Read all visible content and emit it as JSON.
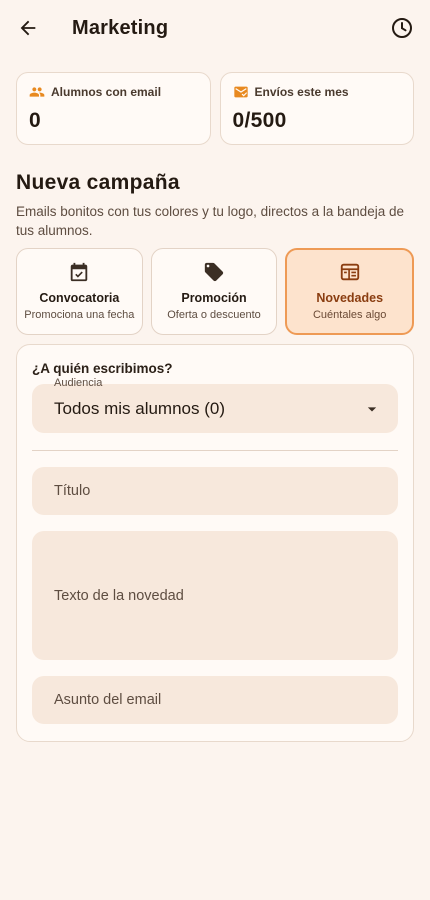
{
  "appbar": {
    "title": "Marketing",
    "back_icon": "arrow-left-icon",
    "history_icon": "clock-icon"
  },
  "stats": [
    {
      "label": "Alumnos con email",
      "value": "0",
      "icon": "people-icon"
    },
    {
      "label": "Envíos este mes",
      "value": "0/500",
      "icon": "mail-check-icon"
    }
  ],
  "campaign": {
    "title": "Nueva campaña",
    "description": "Emails bonitos con tus colores y tu logo, directos a la bandeja de tus alumnos."
  },
  "types": [
    {
      "name": "Convocatoria",
      "subtitle": "Promociona una fecha",
      "icon": "calendar-check-icon",
      "selected": false
    },
    {
      "name": "Promoción",
      "subtitle": "Oferta o descuento",
      "icon": "tag-icon",
      "selected": false
    },
    {
      "name": "Novedades",
      "subtitle": "Cuéntales algo",
      "icon": "newspaper-icon",
      "selected": true
    }
  ],
  "form": {
    "question": "¿A quién escribimos?",
    "audience_label": "Audiencia",
    "audience_value": "Todos mis alumnos (0)",
    "title_placeholder": "Título",
    "body_placeholder": "Texto de la novedad",
    "subject_placeholder": "Asunto del email"
  },
  "colors": {
    "background": "#fcf4ee",
    "accent": "#e8891f",
    "selected_border": "#ee9a55",
    "selected_fill": "#fde3cd",
    "field_fill": "#f7e8dc"
  }
}
